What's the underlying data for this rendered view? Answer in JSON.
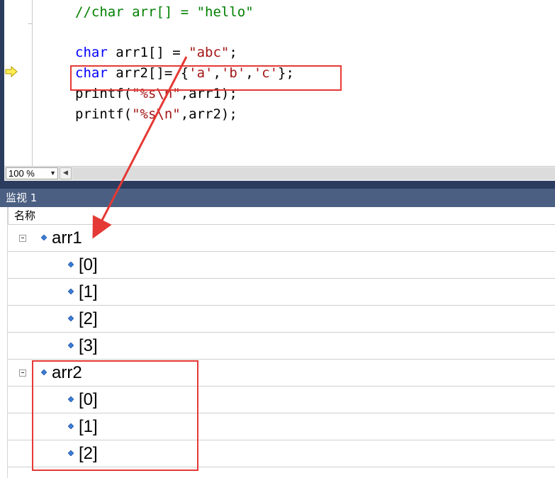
{
  "editor": {
    "lines": [
      {
        "comment": "//char arr[] = \"hello\""
      },
      {
        "kw": "char",
        "text": " arr1[] = ",
        "str": "\"abc\"",
        "tail": ";"
      },
      {
        "kw": "char",
        "text": " arr2[]= {",
        "str1": "'a'",
        "sep1": ",",
        "str2": "'b'",
        "sep2": ",",
        "str3": "'c'",
        "tail": "};"
      },
      {
        "pre": "printf(",
        "str": "\"%s\\n\"",
        "tail": ",arr1);"
      },
      {
        "pre": "printf(",
        "str": "\"%s\\n\"",
        "tail": ",arr2);"
      }
    ],
    "colors": {
      "keyword": "#0000ff",
      "string": "#a31515",
      "comment": "#008000"
    }
  },
  "status": {
    "zoom": "100 %"
  },
  "watch": {
    "title": "监视 1",
    "column_name": "名称",
    "rows": [
      {
        "label": "arr1",
        "level": 0,
        "expanded": true
      },
      {
        "label": "[0]",
        "level": 1
      },
      {
        "label": "[1]",
        "level": 1
      },
      {
        "label": "[2]",
        "level": 1
      },
      {
        "label": "[3]",
        "level": 1
      },
      {
        "label": "arr2",
        "level": 0,
        "expanded": true
      },
      {
        "label": "[0]",
        "level": 1
      },
      {
        "label": "[1]",
        "level": 1
      },
      {
        "label": "[2]",
        "level": 1
      }
    ]
  },
  "annotation_color": "#e53935",
  "icons": {
    "current_line": "current-statement-arrow-icon",
    "member": "watch-member-icon",
    "collapse": "collapse-icon"
  }
}
